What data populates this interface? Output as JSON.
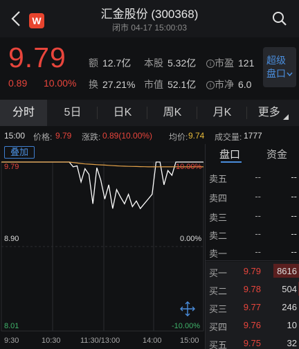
{
  "header": {
    "title": "汇金股份 (300368)",
    "subtitle": "闭市 04-17 15:00:03",
    "logo_letter": "W"
  },
  "quote": {
    "price": "9.79",
    "change": "0.89",
    "change_pct": "10.00%",
    "fields": [
      {
        "k": "额",
        "v": "12.7亿"
      },
      {
        "k": "本股",
        "v": "5.32亿"
      },
      {
        "k": "市盈",
        "v": "121",
        "info": true
      },
      {
        "k": "换",
        "v": "27.21%"
      },
      {
        "k": "市值",
        "v": "52.1亿"
      },
      {
        "k": "市净",
        "v": "6.0",
        "info": true
      }
    ],
    "super_line1": "超级",
    "super_line2": "盘口"
  },
  "tabs": [
    "分时",
    "5日",
    "日K",
    "周K",
    "月K",
    "更多"
  ],
  "strip": {
    "time": "15:00",
    "price_label": "价格:",
    "price": "9.79",
    "change_label": "涨跌:",
    "change": "0.89(10.00%)",
    "avg_label": "均价:",
    "avg": "9.74",
    "volume_label": "成交量:",
    "volume": "1777"
  },
  "chart": {
    "overlay_label": "叠加",
    "price_top": "9.79",
    "price_mid": "8.90",
    "price_bottom": "8.01",
    "pct_top": "10.00%",
    "pct_mid": "0.00%",
    "pct_bottom": "-10.00%",
    "times": [
      "9:30",
      "10:30",
      "11:30/13:00",
      "14:00",
      "15:00"
    ]
  },
  "chart_data": {
    "type": "line",
    "ylim": [
      8.01,
      9.79
    ],
    "x": [
      "9:30",
      "10:30",
      "11:30/13:00",
      "14:00",
      "15:00"
    ],
    "series": [
      {
        "name": "",
        "color": "#ffffff",
        "values": [
          9.79,
          9.79,
          9.79,
          9.79,
          9.79,
          9.79,
          9.79,
          9.79,
          9.79,
          9.79,
          9.79,
          9.79,
          9.79,
          9.79,
          9.79,
          9.79,
          9.79,
          9.79,
          9.79,
          9.79,
          9.79,
          9.79,
          9.74,
          9.75,
          9.58,
          9.72,
          9.66,
          9.35,
          9.73,
          9.6,
          9.4,
          9.55,
          9.3,
          9.5,
          9.42,
          9.35,
          9.45,
          9.32,
          9.38,
          9.3,
          9.35,
          9.4,
          9.45,
          9.79,
          9.79,
          9.55,
          9.7,
          9.65,
          9.79,
          9.79,
          9.79,
          9.79,
          9.79,
          9.79,
          9.79,
          9.79
        ]
      },
      {
        "name": "",
        "color": "#e5a34a",
        "values": [
          9.79,
          9.79,
          9.79,
          9.79,
          9.79,
          9.79,
          9.79,
          9.79,
          9.79,
          9.79,
          9.79,
          9.79,
          9.79,
          9.79,
          9.79,
          9.79,
          9.79,
          9.79,
          9.79,
          9.79,
          9.79,
          9.79,
          9.785,
          9.78,
          9.775,
          9.77,
          9.768,
          9.765,
          9.762,
          9.76,
          9.758,
          9.755,
          9.752,
          9.75,
          9.748,
          9.746,
          9.745,
          9.744,
          9.743,
          9.742,
          9.741,
          9.74,
          9.74,
          9.74,
          9.74,
          9.74,
          9.74,
          9.74,
          9.74,
          9.74,
          9.74,
          9.74,
          9.74,
          9.74,
          9.74,
          9.74
        ]
      }
    ]
  },
  "book": {
    "tab_active": "盘口",
    "tab_other": "资金",
    "asks": [
      {
        "label": "卖五",
        "price": "--",
        "vol": "--"
      },
      {
        "label": "卖四",
        "price": "--",
        "vol": "--"
      },
      {
        "label": "卖三",
        "price": "--",
        "vol": "--"
      },
      {
        "label": "卖二",
        "price": "--",
        "vol": "--"
      },
      {
        "label": "卖一",
        "price": "--",
        "vol": "--"
      }
    ],
    "bids": [
      {
        "label": "买一",
        "price": "9.79",
        "vol": "8616",
        "bar": 1.0
      },
      {
        "label": "买二",
        "price": "9.78",
        "vol": "504",
        "bar": 0.06
      },
      {
        "label": "买三",
        "price": "9.77",
        "vol": "246",
        "bar": 0.03
      },
      {
        "label": "买四",
        "price": "9.76",
        "vol": "10",
        "bar": 0.0
      },
      {
        "label": "买五",
        "price": "9.75",
        "vol": "32",
        "bar": 0.0
      }
    ]
  },
  "colors": {
    "up": "#e8453c",
    "avg": "#e5b93a",
    "accent": "#4a8ddc",
    "background": "#111214"
  },
  "icons": [
    "back-arrow-icon",
    "search-icon",
    "info-icon",
    "chevron-down-icon",
    "move-arrows-icon"
  ]
}
